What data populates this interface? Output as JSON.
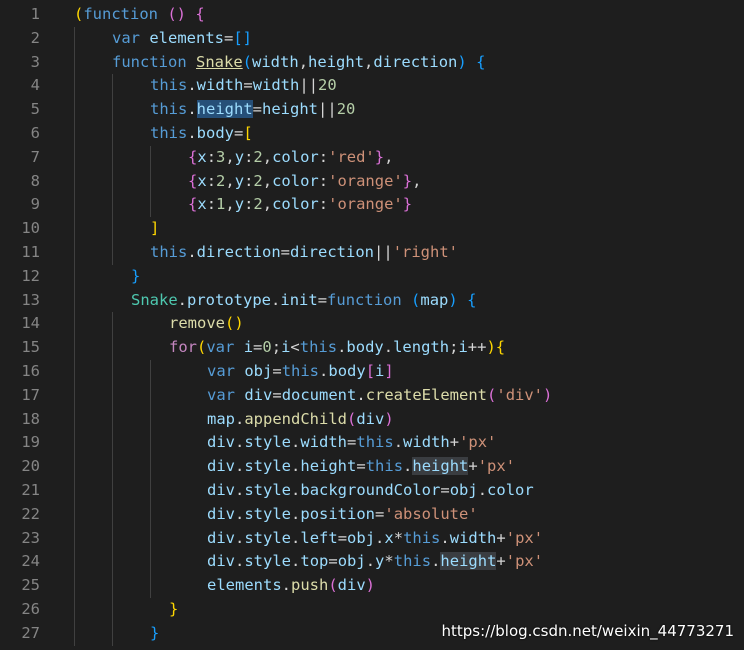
{
  "editor": {
    "lines": [
      {
        "no": "1",
        "indent": 0,
        "tokens": [
          {
            "t": "(",
            "c": "t-p1"
          },
          {
            "t": "function",
            "c": "t-kw"
          },
          {
            "t": " "
          },
          {
            "t": "()",
            "c": "t-p2"
          },
          {
            "t": " "
          },
          {
            "t": "{",
            "c": "t-p2"
          }
        ]
      },
      {
        "no": "2",
        "indent": 1,
        "tokens": [
          {
            "t": "var",
            "c": "t-kw"
          },
          {
            "t": " "
          },
          {
            "t": "elements",
            "c": "t-var"
          },
          {
            "t": "=",
            "c": "t-op"
          },
          {
            "t": "[]",
            "c": "t-p3"
          }
        ]
      },
      {
        "no": "3",
        "indent": 1,
        "tokens": [
          {
            "t": "function",
            "c": "t-kw"
          },
          {
            "t": " "
          },
          {
            "t": "Snake",
            "c": "t-fn ul"
          },
          {
            "t": "(",
            "c": "t-p3"
          },
          {
            "t": "width",
            "c": "t-var"
          },
          {
            "t": ","
          },
          {
            "t": "height",
            "c": "t-var"
          },
          {
            "t": ","
          },
          {
            "t": "direction",
            "c": "t-var"
          },
          {
            "t": ")",
            "c": "t-p3"
          },
          {
            "t": " "
          },
          {
            "t": "{",
            "c": "t-p3"
          }
        ]
      },
      {
        "no": "4",
        "indent": 2,
        "tokens": [
          {
            "t": "this",
            "c": "t-kw"
          },
          {
            "t": "."
          },
          {
            "t": "width",
            "c": "t-var"
          },
          {
            "t": "=",
            "c": "t-op"
          },
          {
            "t": "width",
            "c": "t-var"
          },
          {
            "t": "||",
            "c": "t-op"
          },
          {
            "t": "20",
            "c": "t-num"
          }
        ]
      },
      {
        "no": "5",
        "indent": 2,
        "tokens": [
          {
            "t": "this",
            "c": "t-kw"
          },
          {
            "t": "."
          },
          {
            "t": "height",
            "c": "t-var hl-sel"
          },
          {
            "t": "=",
            "c": "t-op"
          },
          {
            "t": "height",
            "c": "t-var"
          },
          {
            "t": "||",
            "c": "t-op"
          },
          {
            "t": "20",
            "c": "t-num"
          }
        ]
      },
      {
        "no": "6",
        "indent": 2,
        "tokens": [
          {
            "t": "this",
            "c": "t-kw"
          },
          {
            "t": "."
          },
          {
            "t": "body",
            "c": "t-var"
          },
          {
            "t": "=",
            "c": "t-op"
          },
          {
            "t": "[",
            "c": "t-p1"
          }
        ]
      },
      {
        "no": "7",
        "indent": 3,
        "tokens": [
          {
            "t": "{",
            "c": "t-p2"
          },
          {
            "t": "x",
            "c": "t-var"
          },
          {
            "t": ":"
          },
          {
            "t": "3",
            "c": "t-num"
          },
          {
            "t": ","
          },
          {
            "t": "y",
            "c": "t-var"
          },
          {
            "t": ":"
          },
          {
            "t": "2",
            "c": "t-num"
          },
          {
            "t": ","
          },
          {
            "t": "color",
            "c": "t-var"
          },
          {
            "t": ":"
          },
          {
            "t": "'red'",
            "c": "t-str"
          },
          {
            "t": "}",
            "c": "t-p2"
          },
          {
            "t": ","
          }
        ]
      },
      {
        "no": "8",
        "indent": 3,
        "tokens": [
          {
            "t": "{",
            "c": "t-p2"
          },
          {
            "t": "x",
            "c": "t-var"
          },
          {
            "t": ":"
          },
          {
            "t": "2",
            "c": "t-num"
          },
          {
            "t": ","
          },
          {
            "t": "y",
            "c": "t-var"
          },
          {
            "t": ":"
          },
          {
            "t": "2",
            "c": "t-num"
          },
          {
            "t": ","
          },
          {
            "t": "color",
            "c": "t-var"
          },
          {
            "t": ":"
          },
          {
            "t": "'orange'",
            "c": "t-str"
          },
          {
            "t": "}",
            "c": "t-p2"
          },
          {
            "t": ","
          }
        ]
      },
      {
        "no": "9",
        "indent": 3,
        "tokens": [
          {
            "t": "{",
            "c": "t-p2"
          },
          {
            "t": "x",
            "c": "t-var"
          },
          {
            "t": ":"
          },
          {
            "t": "1",
            "c": "t-num"
          },
          {
            "t": ","
          },
          {
            "t": "y",
            "c": "t-var"
          },
          {
            "t": ":"
          },
          {
            "t": "2",
            "c": "t-num"
          },
          {
            "t": ","
          },
          {
            "t": "color",
            "c": "t-var"
          },
          {
            "t": ":"
          },
          {
            "t": "'orange'",
            "c": "t-str"
          },
          {
            "t": "}",
            "c": "t-p2"
          }
        ]
      },
      {
        "no": "10",
        "indent": 2,
        "tokens": [
          {
            "t": "]",
            "c": "t-p1"
          }
        ]
      },
      {
        "no": "11",
        "indent": 2,
        "tokens": [
          {
            "t": "this",
            "c": "t-kw"
          },
          {
            "t": "."
          },
          {
            "t": "direction",
            "c": "t-var"
          },
          {
            "t": "=",
            "c": "t-op"
          },
          {
            "t": "direction",
            "c": "t-var"
          },
          {
            "t": "||",
            "c": "t-op"
          },
          {
            "t": "'right'",
            "c": "t-str"
          }
        ]
      },
      {
        "no": "12",
        "indent": 1.5,
        "tokens": [
          {
            "t": "}",
            "c": "t-p3"
          }
        ]
      },
      {
        "no": "13",
        "indent": 1.5,
        "tokens": [
          {
            "t": "Snake",
            "c": "t-cls"
          },
          {
            "t": "."
          },
          {
            "t": "prototype",
            "c": "t-var"
          },
          {
            "t": "."
          },
          {
            "t": "init",
            "c": "t-var"
          },
          {
            "t": "=",
            "c": "t-op"
          },
          {
            "t": "function",
            "c": "t-kw"
          },
          {
            "t": " "
          },
          {
            "t": "(",
            "c": "t-p3"
          },
          {
            "t": "map",
            "c": "t-var"
          },
          {
            "t": ")",
            "c": "t-p3"
          },
          {
            "t": " "
          },
          {
            "t": "{",
            "c": "t-p3"
          }
        ]
      },
      {
        "no": "14",
        "indent": 2.5,
        "tokens": [
          {
            "t": "remove",
            "c": "t-fn"
          },
          {
            "t": "()",
            "c": "t-p1"
          }
        ]
      },
      {
        "no": "15",
        "indent": 2.5,
        "tokens": [
          {
            "t": "for",
            "c": "t-ctrl"
          },
          {
            "t": "(",
            "c": "t-p1"
          },
          {
            "t": "var",
            "c": "t-kw"
          },
          {
            "t": " "
          },
          {
            "t": "i",
            "c": "t-var"
          },
          {
            "t": "=",
            "c": "t-op"
          },
          {
            "t": "0",
            "c": "t-num"
          },
          {
            "t": ";"
          },
          {
            "t": "i",
            "c": "t-var"
          },
          {
            "t": "<",
            "c": "t-op"
          },
          {
            "t": "this",
            "c": "t-kw"
          },
          {
            "t": "."
          },
          {
            "t": "body",
            "c": "t-var"
          },
          {
            "t": "."
          },
          {
            "t": "length",
            "c": "t-var"
          },
          {
            "t": ";"
          },
          {
            "t": "i",
            "c": "t-var"
          },
          {
            "t": "++",
            "c": "t-op"
          },
          {
            "t": ")",
            "c": "t-p1"
          },
          {
            "t": "{",
            "c": "t-p1"
          }
        ]
      },
      {
        "no": "16",
        "indent": 3.5,
        "tokens": [
          {
            "t": "var",
            "c": "t-kw"
          },
          {
            "t": " "
          },
          {
            "t": "obj",
            "c": "t-var"
          },
          {
            "t": "=",
            "c": "t-op"
          },
          {
            "t": "this",
            "c": "t-kw"
          },
          {
            "t": "."
          },
          {
            "t": "body",
            "c": "t-var"
          },
          {
            "t": "[",
            "c": "t-p2"
          },
          {
            "t": "i",
            "c": "t-var"
          },
          {
            "t": "]",
            "c": "t-p2"
          }
        ]
      },
      {
        "no": "17",
        "indent": 3.5,
        "tokens": [
          {
            "t": "var",
            "c": "t-kw"
          },
          {
            "t": " "
          },
          {
            "t": "div",
            "c": "t-var"
          },
          {
            "t": "=",
            "c": "t-op"
          },
          {
            "t": "document",
            "c": "t-var"
          },
          {
            "t": "."
          },
          {
            "t": "createElement",
            "c": "t-fn"
          },
          {
            "t": "(",
            "c": "t-p2"
          },
          {
            "t": "'div'",
            "c": "t-str"
          },
          {
            "t": ")",
            "c": "t-p2"
          }
        ]
      },
      {
        "no": "18",
        "indent": 3.5,
        "tokens": [
          {
            "t": "map",
            "c": "t-var"
          },
          {
            "t": "."
          },
          {
            "t": "appendChild",
            "c": "t-fn"
          },
          {
            "t": "(",
            "c": "t-p2"
          },
          {
            "t": "div",
            "c": "t-var"
          },
          {
            "t": ")",
            "c": "t-p2"
          }
        ]
      },
      {
        "no": "19",
        "indent": 3.5,
        "tokens": [
          {
            "t": "div",
            "c": "t-var"
          },
          {
            "t": "."
          },
          {
            "t": "style",
            "c": "t-var"
          },
          {
            "t": "."
          },
          {
            "t": "width",
            "c": "t-var"
          },
          {
            "t": "=",
            "c": "t-op"
          },
          {
            "t": "this",
            "c": "t-kw"
          },
          {
            "t": "."
          },
          {
            "t": "width",
            "c": "t-var"
          },
          {
            "t": "+",
            "c": "t-op"
          },
          {
            "t": "'px'",
            "c": "t-str"
          }
        ]
      },
      {
        "no": "20",
        "indent": 3.5,
        "tokens": [
          {
            "t": "div",
            "c": "t-var"
          },
          {
            "t": "."
          },
          {
            "t": "style",
            "c": "t-var"
          },
          {
            "t": "."
          },
          {
            "t": "height",
            "c": "t-var"
          },
          {
            "t": "=",
            "c": "t-op"
          },
          {
            "t": "this",
            "c": "t-kw"
          },
          {
            "t": "."
          },
          {
            "t": "height",
            "c": "t-var hl-word"
          },
          {
            "t": "+",
            "c": "t-op"
          },
          {
            "t": "'px'",
            "c": "t-str"
          }
        ]
      },
      {
        "no": "21",
        "indent": 3.5,
        "tokens": [
          {
            "t": "div",
            "c": "t-var"
          },
          {
            "t": "."
          },
          {
            "t": "style",
            "c": "t-var"
          },
          {
            "t": "."
          },
          {
            "t": "backgroundColor",
            "c": "t-var"
          },
          {
            "t": "=",
            "c": "t-op"
          },
          {
            "t": "obj",
            "c": "t-var"
          },
          {
            "t": "."
          },
          {
            "t": "color",
            "c": "t-var"
          }
        ]
      },
      {
        "no": "22",
        "indent": 3.5,
        "tokens": [
          {
            "t": "div",
            "c": "t-var"
          },
          {
            "t": "."
          },
          {
            "t": "style",
            "c": "t-var"
          },
          {
            "t": "."
          },
          {
            "t": "position",
            "c": "t-var"
          },
          {
            "t": "=",
            "c": "t-op"
          },
          {
            "t": "'absolute'",
            "c": "t-str"
          }
        ]
      },
      {
        "no": "23",
        "indent": 3.5,
        "tokens": [
          {
            "t": "div",
            "c": "t-var"
          },
          {
            "t": "."
          },
          {
            "t": "style",
            "c": "t-var"
          },
          {
            "t": "."
          },
          {
            "t": "left",
            "c": "t-var"
          },
          {
            "t": "=",
            "c": "t-op"
          },
          {
            "t": "obj",
            "c": "t-var"
          },
          {
            "t": "."
          },
          {
            "t": "x",
            "c": "t-var"
          },
          {
            "t": "*",
            "c": "t-op"
          },
          {
            "t": "this",
            "c": "t-kw"
          },
          {
            "t": "."
          },
          {
            "t": "width",
            "c": "t-var"
          },
          {
            "t": "+",
            "c": "t-op"
          },
          {
            "t": "'px'",
            "c": "t-str"
          }
        ]
      },
      {
        "no": "24",
        "indent": 3.5,
        "tokens": [
          {
            "t": "div",
            "c": "t-var"
          },
          {
            "t": "."
          },
          {
            "t": "style",
            "c": "t-var"
          },
          {
            "t": "."
          },
          {
            "t": "top",
            "c": "t-var"
          },
          {
            "t": "=",
            "c": "t-op"
          },
          {
            "t": "obj",
            "c": "t-var"
          },
          {
            "t": "."
          },
          {
            "t": "y",
            "c": "t-var"
          },
          {
            "t": "*",
            "c": "t-op"
          },
          {
            "t": "this",
            "c": "t-kw"
          },
          {
            "t": "."
          },
          {
            "t": "height",
            "c": "t-var hl-word"
          },
          {
            "t": "+",
            "c": "t-op"
          },
          {
            "t": "'px'",
            "c": "t-str"
          }
        ]
      },
      {
        "no": "25",
        "indent": 3.5,
        "tokens": [
          {
            "t": "elements",
            "c": "t-var"
          },
          {
            "t": "."
          },
          {
            "t": "push",
            "c": "t-fn"
          },
          {
            "t": "(",
            "c": "t-p2"
          },
          {
            "t": "div",
            "c": "t-var"
          },
          {
            "t": ")",
            "c": "t-p2"
          }
        ]
      },
      {
        "no": "26",
        "indent": 2.5,
        "tokens": [
          {
            "t": "}",
            "c": "t-p1"
          }
        ]
      },
      {
        "no": "27",
        "indent": 2,
        "tokens": [
          {
            "t": "}",
            "c": "t-p3"
          }
        ]
      }
    ]
  },
  "watermark": "https://blog.csdn.net/weixin_44773271",
  "theme": {
    "background": "#1e1e1e",
    "keyword": "#569cd6",
    "variable": "#9cdcfe",
    "function": "#dcdcaa",
    "string": "#ce9178",
    "number": "#b5cea8"
  }
}
